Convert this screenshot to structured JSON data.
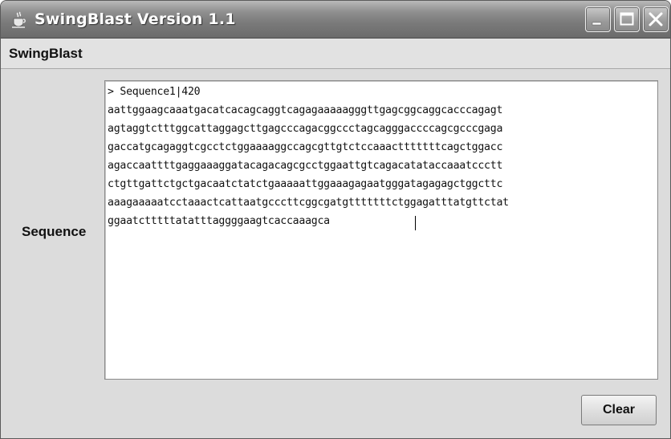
{
  "window": {
    "title": "SwingBlast Version 1.1",
    "icon": "java-cup-icon",
    "controls": [
      "minimize-icon",
      "maximize-icon",
      "close-icon"
    ]
  },
  "menubar": {
    "items": [
      {
        "label": "SwingBlast"
      }
    ]
  },
  "form": {
    "sequence_label": "Sequence",
    "text_lines": [
      "> Sequence1|420",
      "aattggaagcaaatgacatcacagcaggtcagagaaaaagggttgagcggcaggcacccagagt",
      "agtaggtctttggcattaggagcttgagcccagacggccctagcagggaccccagcgcccgaga",
      "gaccatgcagaggtcgcctctggaaaaggccagcgttgtctccaaactttttttcagctggacc",
      "agaccaattttgaggaaaggatacagacagcgcctggaattgtcagacatataccaaatccctt",
      "ctgttgattctgctgacaatctatctgaaaaattggaaagagaatgggatagagagctggcttc",
      "aaagaaaaatcctaaactcattaatgcccttcggcgatgtttttttctggagatttatgttctat",
      "ggaatctttttatatttaggggaagtcaccaaagca"
    ],
    "clear_label": "Clear"
  },
  "colors": {
    "titlebar": "#7a7a7a",
    "window_bg": "#dcdcdc",
    "textarea_bg": "#ffffff"
  }
}
